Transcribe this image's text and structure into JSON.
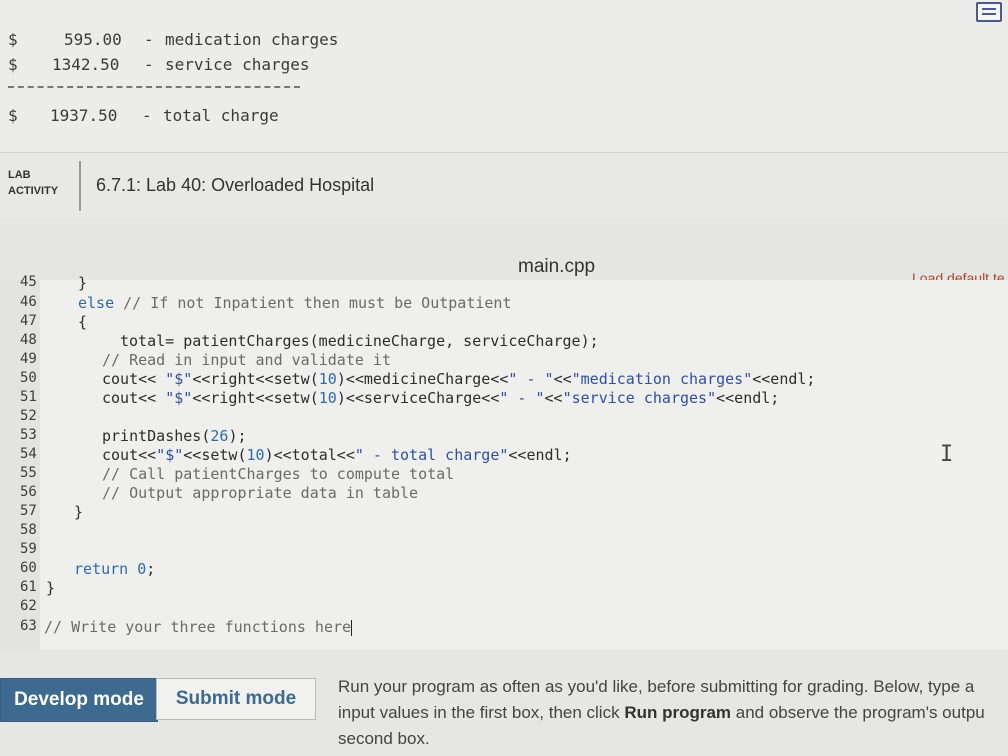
{
  "sample_output": {
    "rows": [
      {
        "currency": "$",
        "amount": "595.00",
        "sep": "-",
        "label": "medication charges"
      },
      {
        "currency": "$",
        "amount": "1342.50",
        "sep": "-",
        "label": "service charges"
      }
    ],
    "dashes": "-------------------------",
    "total": {
      "currency": "$",
      "amount": "1937.50",
      "sep": "-",
      "label": "total charge"
    }
  },
  "lab": {
    "tag_line1": "LAB",
    "tag_line2": "ACTIVITY",
    "title": "6.7.1: Lab 40: Overloaded Hospital"
  },
  "editor": {
    "file_name": "main.cpp",
    "load_default": "Load default te",
    "line_numbers": [
      "45",
      "46",
      "47",
      "48",
      "49",
      "50",
      "51",
      "52",
      "53",
      "54",
      "55",
      "56",
      "57",
      "58",
      "59",
      "60",
      "61",
      "62",
      "63"
    ]
  },
  "code": {
    "l45": "}",
    "l46_kw": "else",
    "l46_cm": " // If not Inpatient then must be Outpatient",
    "l47": "{",
    "l48": "total= patientCharges(medicineCharge, serviceCharge);",
    "l49_cm": "// Read in input and validate it",
    "l50_a": "cout<< ",
    "l50_s1": "\"$\"",
    "l50_b": "<<right<<setw(",
    "l50_n": "10",
    "l50_c": ")<<medicineCharge<<",
    "l50_s2": "\" - \"",
    "l50_d": "<<",
    "l50_s3": "\"medication charges\"",
    "l50_e": "<<endl;",
    "l51_a": "cout<< ",
    "l51_s1": "\"$\"",
    "l51_b": "<<right<<setw(",
    "l51_n": "10",
    "l51_c": ")<<serviceCharge<<",
    "l51_s2": "\" - \"",
    "l51_d": "<<",
    "l51_s3": "\"service charges\"",
    "l51_e": "<<endl;",
    "l53_a": "printDashes(",
    "l53_n": "26",
    "l53_b": ");",
    "l54_a": "cout<<",
    "l54_s1": "\"$\"",
    "l54_b": "<<setw(",
    "l54_n": "10",
    "l54_c": ")<<total<<",
    "l54_s2": "\" - total charge\"",
    "l54_d": "<<endl;",
    "l55_cm": "// Call patientCharges to compute total",
    "l56_cm": "// Output appropriate data in table",
    "l57": "}",
    "l60_kw": "return",
    "l60_n": " 0",
    "l60_b": ";",
    "l61": "}",
    "l63_cm": "// Write your three functions here"
  },
  "modes": {
    "develop": "Develop mode",
    "submit": "Submit mode",
    "instr_line1": "Run your program as often as you'd like, before submitting for grading. Below, type a",
    "instr_line2_a": "input values in the first box, then click ",
    "instr_line2_b": "Run program",
    "instr_line2_c": " and observe the program's outpu",
    "instr_line3": "second box."
  }
}
